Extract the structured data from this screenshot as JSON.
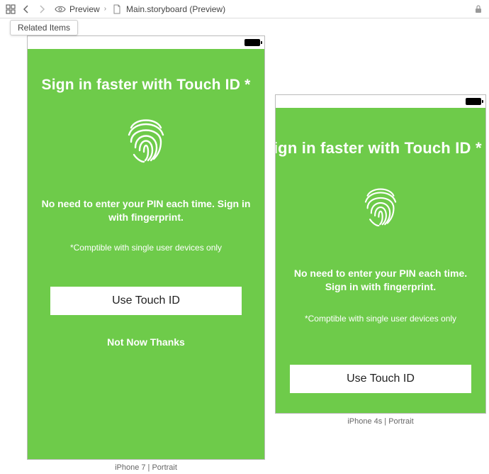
{
  "toolbar": {
    "related_items_label": "Related Items",
    "breadcrumb": {
      "item1": "Preview",
      "item2": "Main.storyboard (Preview)"
    }
  },
  "screen": {
    "title": "Sign in faster with Touch ID *",
    "subtitle": "No need to enter your PIN each time. Sign in with fingerprint.",
    "footnote": "*Comptible with single user devices only",
    "primary_button": "Use Touch ID",
    "secondary_button": "Not Now Thanks"
  },
  "devices": [
    {
      "label": "iPhone 7 | Portrait"
    },
    {
      "label": "iPhone 4s | Portrait"
    }
  ]
}
